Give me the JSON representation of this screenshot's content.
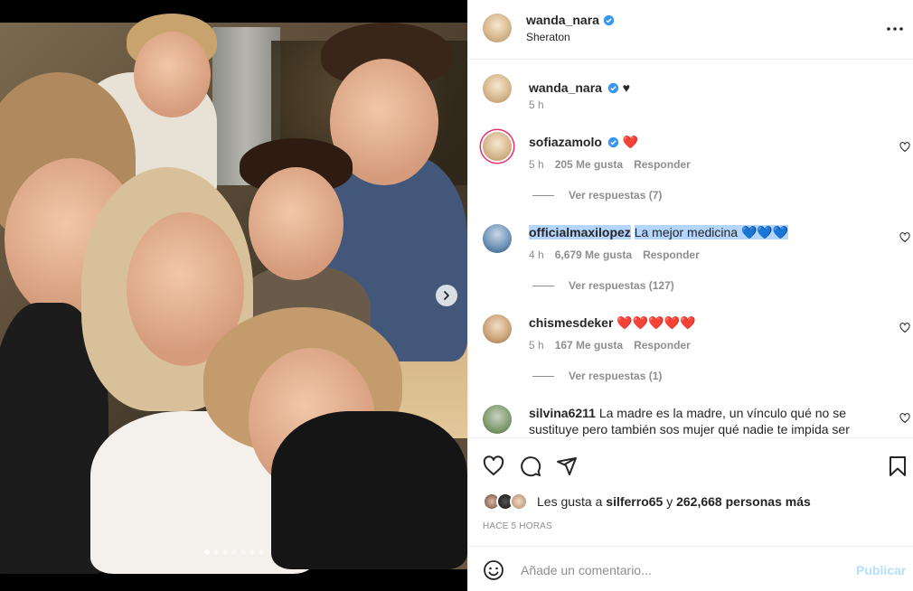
{
  "post": {
    "author": "wanda_nara",
    "location": "Sheraton",
    "caption_extra": "♥",
    "caption_time": "5 h",
    "carousel_total": 7,
    "carousel_index": 1
  },
  "comments": [
    {
      "user": "sofiazamolo",
      "verified": true,
      "text": "❤️",
      "time": "5 h",
      "likes": "205 Me gusta",
      "reply_label": "Responder",
      "view_replies": "Ver respuestas (7)"
    },
    {
      "user": "officialmaxilopez",
      "verified": false,
      "text": "La mejor medicina 💙💙💙",
      "time": "4 h",
      "likes": "6,679 Me gusta",
      "reply_label": "Responder",
      "view_replies": "Ver respuestas (127)"
    },
    {
      "user": "chismesdeker",
      "verified": false,
      "text": "❤️❤️❤️❤️❤️",
      "time": "5 h",
      "likes": "167 Me gusta",
      "reply_label": "Responder",
      "view_replies": "Ver respuestas (1)"
    },
    {
      "user": "silvina6211",
      "verified": false,
      "text": "La madre es la madre, un vínculo qué no se sustituye pero también sos mujer qué nadie te impida ser"
    }
  ],
  "likes": {
    "prefix": "Les gusta a",
    "user": "silferro65",
    "joiner": "y",
    "others": "262,668 personas más"
  },
  "posted_ago": "HACE 5 HORAS",
  "comment_box": {
    "placeholder": "Añade un comentario...",
    "post_label": "Publicar"
  },
  "icons": {
    "like": "heart-icon",
    "comment": "comment-icon",
    "share": "share-icon",
    "save": "bookmark-icon",
    "emoji": "emoji-icon",
    "more": "more-icon",
    "next": "chevron-right-icon"
  },
  "colors": {
    "verified": "#3897f0",
    "muted": "#8e8e8e",
    "publish_disabled": "#b2dffc",
    "selection": "#b4d5fe"
  }
}
